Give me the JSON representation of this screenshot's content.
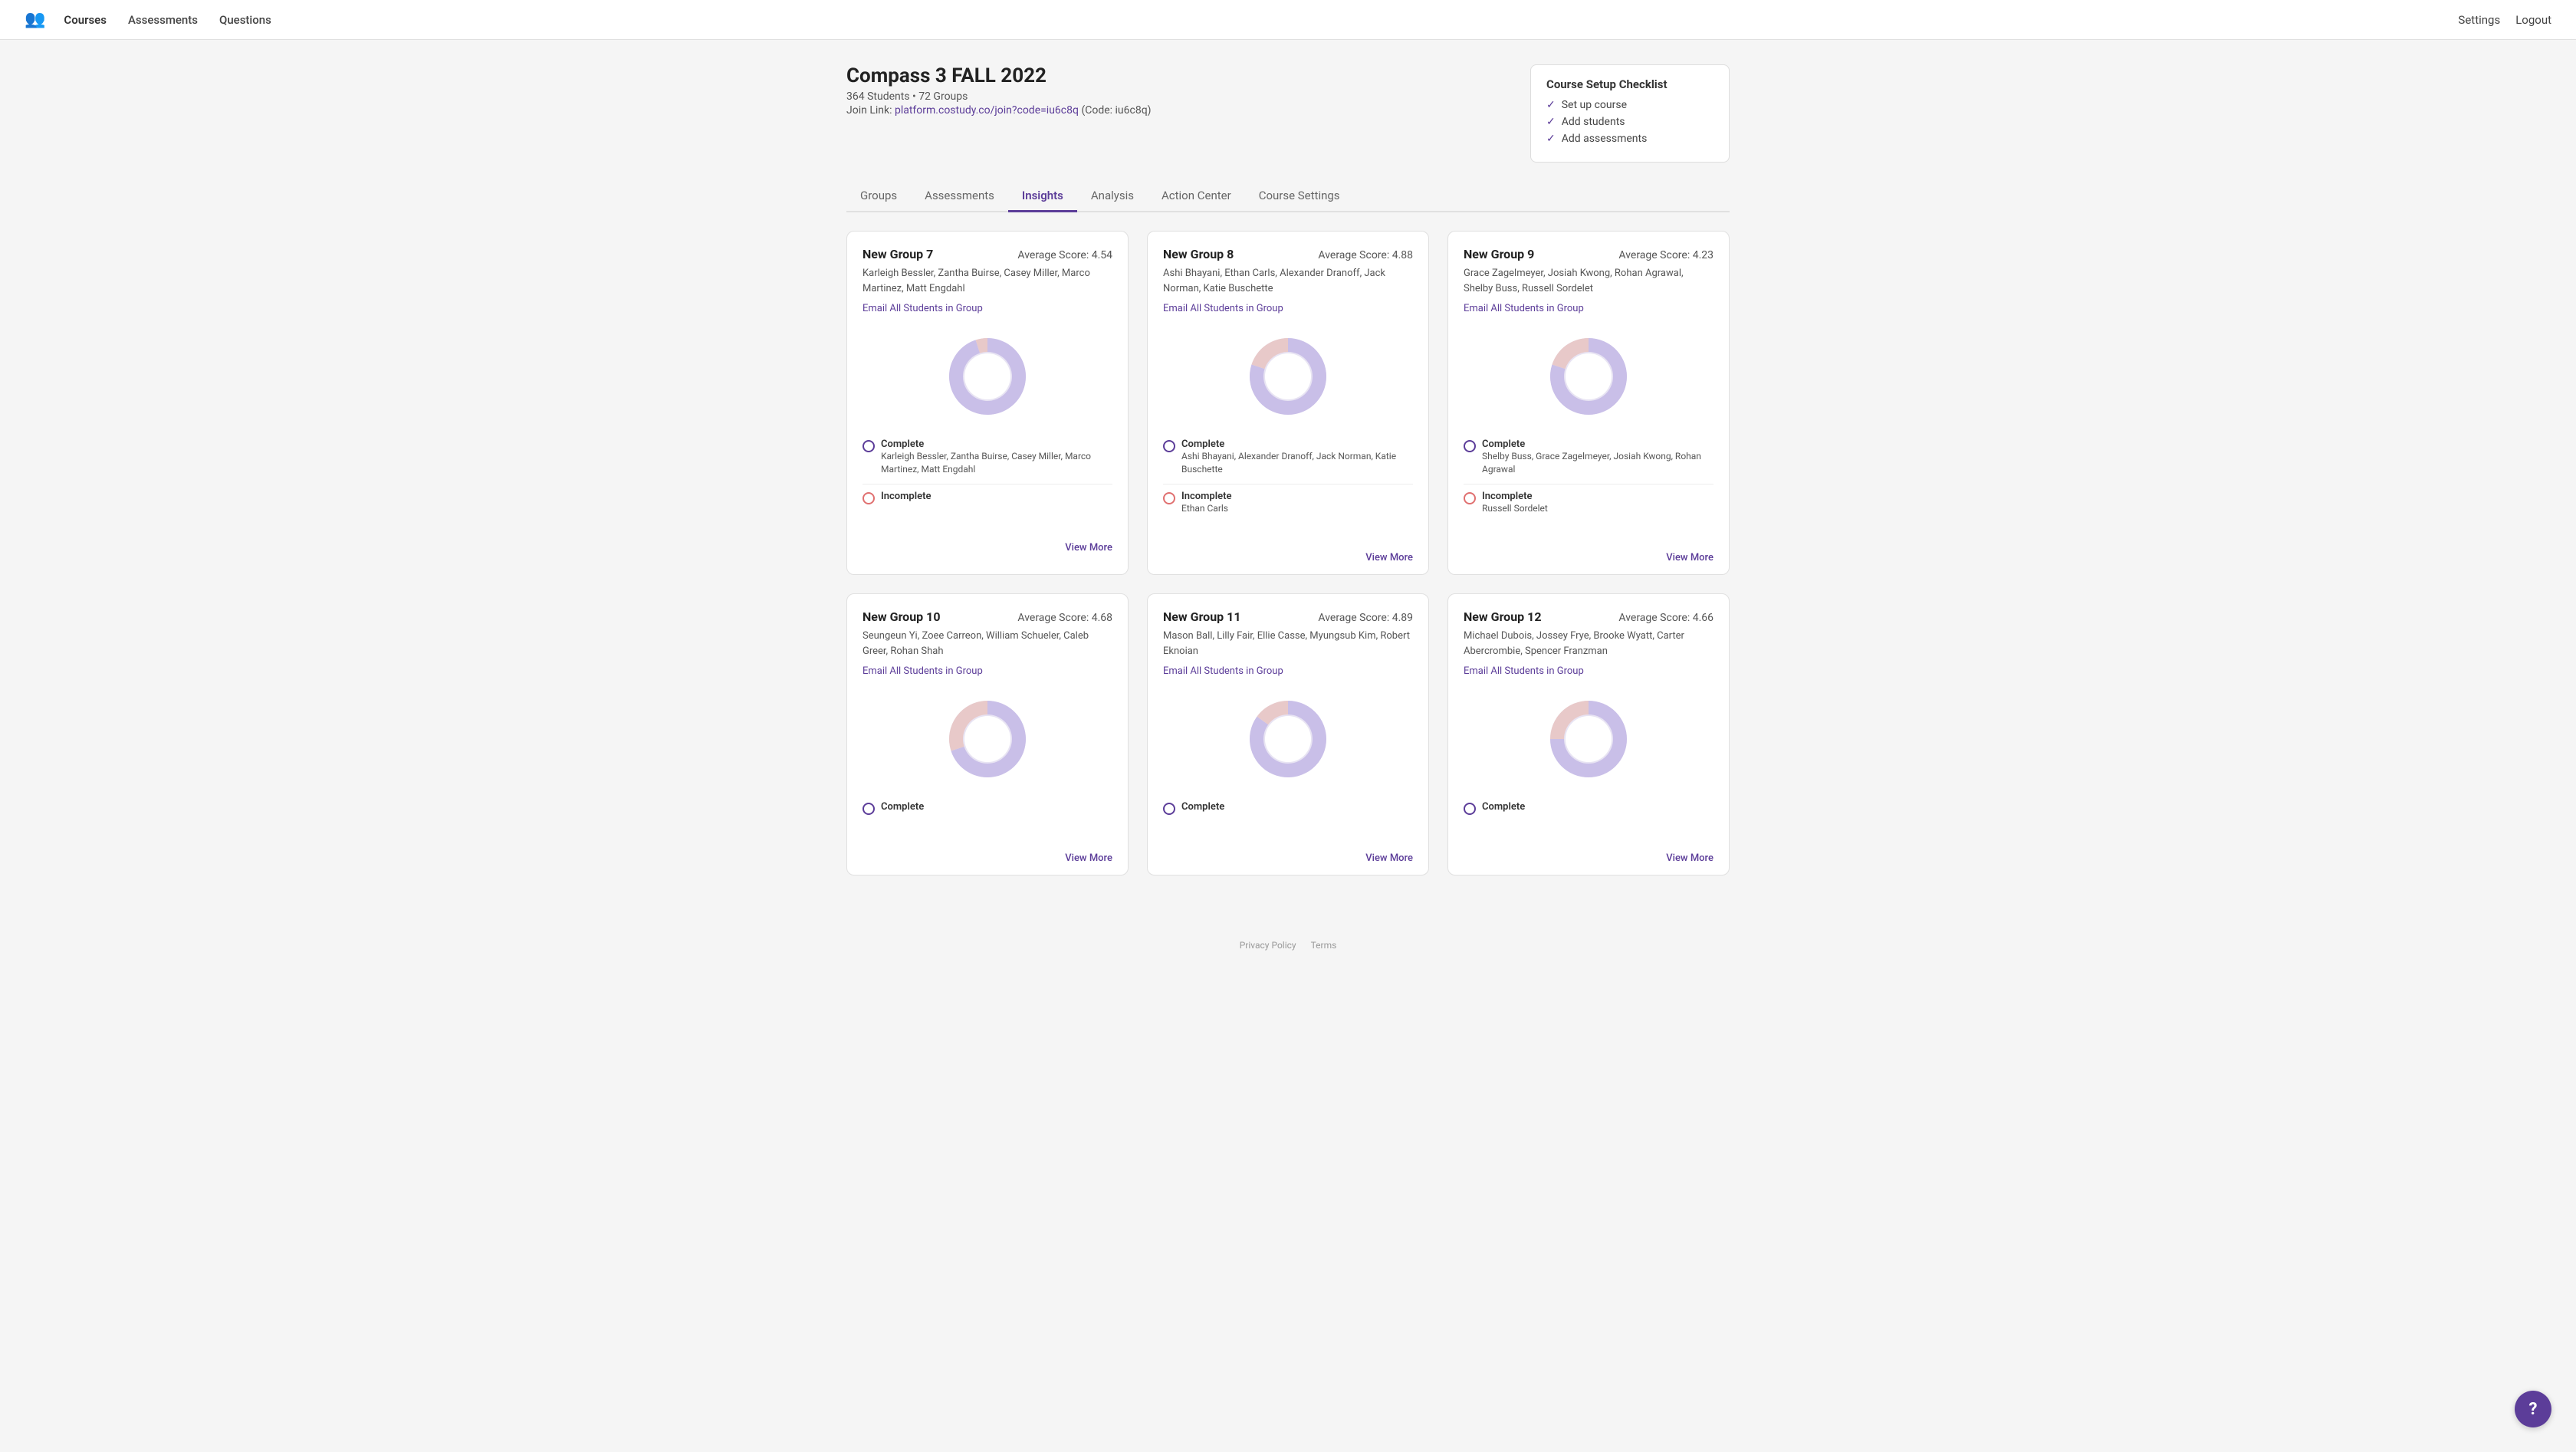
{
  "nav": {
    "logo_icon": "people-icon",
    "links": [
      {
        "label": "Courses",
        "active": true
      },
      {
        "label": "Assessments",
        "active": false
      },
      {
        "label": "Questions",
        "active": false
      }
    ],
    "right_links": [
      {
        "label": "Settings"
      },
      {
        "label": "Logout"
      }
    ]
  },
  "course": {
    "title": "Compass 3 FALL 2022",
    "meta": "364 Students • 72 Groups",
    "join_label": "Join Link:",
    "join_url": "platform.costudy.co/join?code=iu6c8q",
    "join_code": "(Code: iu6c8q)"
  },
  "checklist": {
    "title": "Course Setup Checklist",
    "items": [
      {
        "label": "Set up course"
      },
      {
        "label": "Add students"
      },
      {
        "label": "Add assessments"
      }
    ]
  },
  "tabs": [
    {
      "label": "Groups",
      "active": false
    },
    {
      "label": "Assessments",
      "active": false
    },
    {
      "label": "Insights",
      "active": true
    },
    {
      "label": "Analysis",
      "active": false
    },
    {
      "label": "Action Center",
      "active": false
    },
    {
      "label": "Course Settings",
      "active": false
    }
  ],
  "groups": [
    {
      "name": "New Group 7",
      "avg": "Average Score: 4.54",
      "members": "Karleigh Bessler, Zantha Buirse, Casey Miller, Marco Martinez, Matt Engdahl",
      "email_label": "Email All Students in Group",
      "complete_members": "Karleigh Bessler, Zantha Buirse, Casey Miller, Marco Martinez, Matt Engdahl",
      "incomplete_members": "",
      "complete_pct": 95,
      "incomplete_pct": 5,
      "donut_color_complete": "#c9bfe8",
      "donut_color_incomplete": "#e8c9c9",
      "view_more": "View More"
    },
    {
      "name": "New Group 8",
      "avg": "Average Score: 4.88",
      "members": "Ashi Bhayani, Ethan Carls, Alexander Dranoff, Jack Norman, Katie Buschette",
      "email_label": "Email All Students in Group",
      "complete_members": "Ashi Bhayani, Alexander Dranoff, Jack Norman, Katie Buschette",
      "incomplete_members": "Ethan Carls",
      "complete_pct": 80,
      "incomplete_pct": 20,
      "donut_color_complete": "#c9bfe8",
      "donut_color_incomplete": "#e8c9c9",
      "view_more": "View More"
    },
    {
      "name": "New Group 9",
      "avg": "Average Score: 4.23",
      "members": "Grace Zagelmeyer, Josiah Kwong, Rohan Agrawal, Shelby Buss, Russell Sordelet",
      "email_label": "Email All Students in Group",
      "complete_members": "Shelby Buss, Grace Zagelmeyer, Josiah Kwong, Rohan Agrawal",
      "incomplete_members": "Russell Sordelet",
      "complete_pct": 80,
      "incomplete_pct": 20,
      "donut_color_complete": "#c9bfe8",
      "donut_color_incomplete": "#e8c9c9",
      "view_more": "View More"
    },
    {
      "name": "New Group 10",
      "avg": "Average Score: 4.68",
      "members": "Seungeun Yi, Zoee Carreon, William Schueler, Caleb Greer, Rohan Shah",
      "email_label": "Email All Students in Group",
      "complete_members": "",
      "incomplete_members": "",
      "complete_pct": 70,
      "incomplete_pct": 30,
      "donut_color_complete": "#c9bfe8",
      "donut_color_incomplete": "#e8c9c9",
      "view_more": "View More"
    },
    {
      "name": "New Group 11",
      "avg": "Average Score: 4.89",
      "members": "Mason Ball, Lilly Fair, Ellie Casse, Myungsub Kim, Robert Eknoian",
      "email_label": "Email All Students in Group",
      "complete_members": "",
      "incomplete_members": "",
      "complete_pct": 85,
      "incomplete_pct": 15,
      "donut_color_complete": "#c9bfe8",
      "donut_color_incomplete": "#e8c9c9",
      "view_more": "View More"
    },
    {
      "name": "New Group 12",
      "avg": "Average Score: 4.66",
      "members": "Michael Dubois, Jossey Frye, Brooke Wyatt, Carter Abercrombie, Spencer Franzman",
      "email_label": "Email All Students in Group",
      "complete_members": "",
      "incomplete_members": "",
      "complete_pct": 75,
      "incomplete_pct": 25,
      "donut_color_complete": "#c9bfe8",
      "donut_color_incomplete": "#e8c9c9",
      "view_more": "View More"
    }
  ],
  "legend": {
    "complete_label": "Complete",
    "incomplete_label": "Incomplete"
  },
  "footer": {
    "privacy": "Privacy Policy",
    "terms": "Terms"
  },
  "help": "?"
}
